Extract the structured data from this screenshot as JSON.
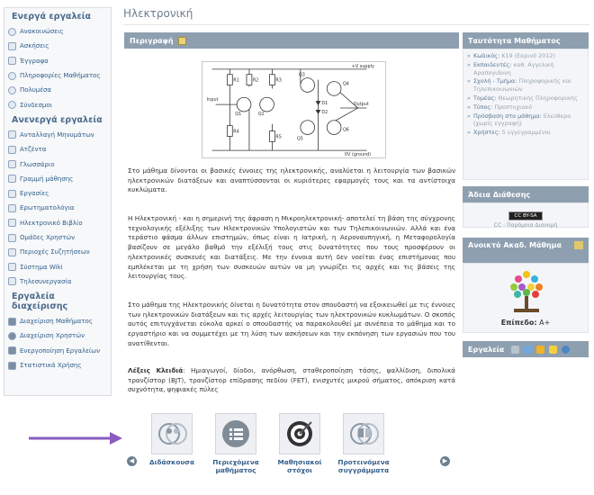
{
  "sidebar": {
    "active_title": "Ενεργά εργαλεία",
    "active_items": [
      "Ανακοινώσεις",
      "Ασκήσεις",
      "Έγγραφα",
      "Πληροφορίες Μαθήματος",
      "Πολυμέσα",
      "Σύνδεσμοι"
    ],
    "inactive_title": "Ανενεργά εργαλεία",
    "inactive_items": [
      "Ανταλλαγή Μηνυμάτων",
      "Ατζέντα",
      "Γλωσσάριο",
      "Γραμμή μάθησης",
      "Εργασίες",
      "Ερωτηματολόγια",
      "Ηλεκτρονικό Βιβλίο",
      "Ομάδες Χρηστών",
      "Περιοχές Συζητήσεων",
      "Σύστημα Wiki",
      "Τηλεσυνεργασία"
    ],
    "admin_title": "Εργαλεία διαχείρισης",
    "admin_items": [
      "Διαχείριση Μαθήματος",
      "Διαχείριση Χρηστών",
      "Ενεργοποίηση Εργαλείων",
      "Στατιστικά Χρήσης"
    ]
  },
  "page": {
    "title": "Ηλεκτρονική"
  },
  "description": {
    "header": "Περιγραφή",
    "paragraph1": "Στο μάθημα δίνονται οι βασικές έννοιες της ηλεκτρονικής, αναλύεται η λειτουργία των βασικών ηλεκτρονικών διατάξεων και αναπτύσσονται οι κυριότερες εφαρμογές τους και τα αντίστοιχα κυκλώματα.",
    "paragraph2": "Η Ηλεκτρονική - και η σημερινή της άφραση η Μικροηλεκτρονική- αποτελεί τη βάση της σύγχρονης τεχνολογικής εξέλιξης των Ηλεκτρονικών Υπολογιστών και των Τηλεπικοινωνιών. Αλλά και ένα τεράστιο φάσμα άλλων επιστημών, όπως είναι η Ιατρική, η Αεροναυπηγική, η Μεταφορολογία βασίζουν σε μεγάλο βαθμό την εξέλιξή τους στις δυνατότητες που τους προσφέρουν οι ηλεκτρονικές συσκευές και διατάξεις. Με την έννοια αυτή δεν νοείται ένας επιστήμονας που εμπλέκεται με τη χρήση των συσκευών αυτών να μη γνωρίζει τις αρχές και τις βάσεις της λειτουργίας τους.",
    "paragraph3": "Στο μάθημα της Ηλεκτρονικής δίνεται η δυνατότητα στον σπουδαστή να εξοικειωθεί με τις έννοιες των ηλεκτρονικών διατάξεων και τις αρχές λειτουργίας των ηλεκτρονικών κυκλωμάτων. Ο σκοπός αυτός επιτυγχάνεται εύκολα αρκεί ο σπουδαστής να παρακολουθεί με συνέπεια το μάθημα και το εργαστήριο και να συμμετέχει με τη λύση των ασκήσεων και την εκπόνηση των εργασιών που του ανατίθενται.",
    "keywords_label": "Λέξεις Κλειδιά",
    "keywords": ": Ημιαγωγοί, δίοδοι, ανόρθωση, σταθεροποίηση τάσης, ψαλλίδιση, διπολικά τρανζίστορ (BJT), τρανζίστορ επίδρασης πεδίου (FET), ενισχυτές μικρού σήματος, απόκριση κατά συχνότητα, ψηφιακές πύλες"
  },
  "circuit": {
    "labels": [
      "Input",
      "Q1",
      "Q2",
      "Q3",
      "Q4",
      "Q5",
      "Q6",
      "D1",
      "D2",
      "R1",
      "R2",
      "R3",
      "R4",
      "R5",
      "+V supply",
      "Output",
      "0V (ground)"
    ]
  },
  "course_identity": {
    "header": "Ταυτότητα Μαθήματος",
    "rows": [
      {
        "key": "Κωδικός:",
        "value": "Κ19 (Εαρινό 2012)"
      },
      {
        "key": "Εκπαιδευτές:",
        "value": "καθ. Αγγελική Αραπογιάννη"
      },
      {
        "key": "Σχολή - Τμήμα:",
        "value": "Πληροφορικής και Τηλεπικοινωνιών"
      },
      {
        "key": "Τομέας:",
        "value": "Θεωρητικής Πληροφορικής"
      },
      {
        "key": "Τύπος:",
        "value": "Προπτυχιακό"
      },
      {
        "key": "Πρόσβαση στο μάθημα:",
        "value": "Ελεύθερο (χωρίς εγγραφή)"
      },
      {
        "key": "Χρήστες:",
        "value": "5 εγγεγραμμένοι"
      }
    ]
  },
  "license": {
    "header": "Άδεια Διάθεσης",
    "badge": "CC BY-SA",
    "text": "CC - Παρόμοια Διανομή"
  },
  "open_course": {
    "header": "Ανοικτό Ακαδ. Μάθημα",
    "level_label": "Επίπεδο:",
    "level_value": "A+"
  },
  "tools": {
    "header": "Εργαλεία"
  },
  "shortcuts": [
    {
      "label1": "Διδάσκουσα",
      "label2": ""
    },
    {
      "label1": "Περιεχόμενα",
      "label2": "μαθήματος"
    },
    {
      "label1": "Μαθησιακοί",
      "label2": "στόχοι"
    },
    {
      "label1": "Προτεινόμενα",
      "label2": "συγγράμματα"
    }
  ],
  "colors": {
    "header_bg": "#8e9fb0",
    "link": "#2f5d8a",
    "arrow": "#8a5bc0"
  }
}
